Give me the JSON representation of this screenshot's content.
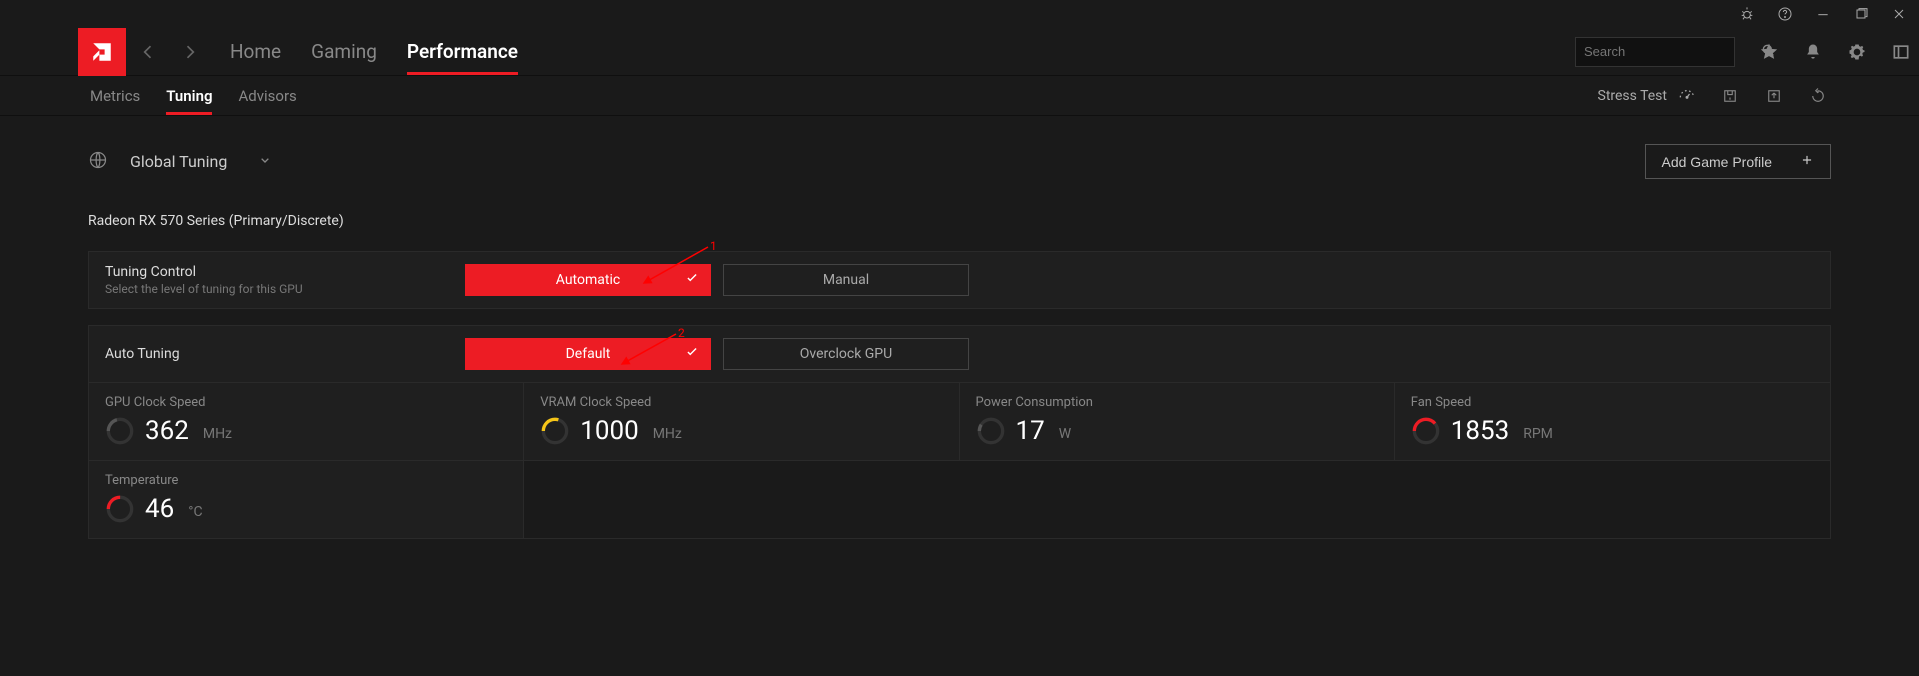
{
  "titlebar": {
    "icons": [
      "bug",
      "help",
      "minimize",
      "maximize",
      "close"
    ]
  },
  "nav": {
    "tabs": [
      "Home",
      "Gaming",
      "Performance"
    ],
    "active": "Performance"
  },
  "search": {
    "placeholder": "Search"
  },
  "subnav": {
    "tabs": [
      "Metrics",
      "Tuning",
      "Advisors"
    ],
    "active": "Tuning",
    "stress_test": "Stress Test"
  },
  "global": {
    "label": "Global Tuning",
    "add_profile": "Add Game Profile"
  },
  "gpu": {
    "name": "Radeon RX 570 Series (Primary/Discrete)"
  },
  "tuning_control": {
    "title": "Tuning Control",
    "subtitle": "Select the level of tuning for this GPU",
    "automatic": "Automatic",
    "manual": "Manual"
  },
  "auto_tuning": {
    "title": "Auto Tuning",
    "default": "Default",
    "overclock": "Overclock GPU"
  },
  "metrics": {
    "gpu_clock": {
      "label": "GPU Clock Speed",
      "value": "362",
      "unit": "MHz",
      "color": "#555"
    },
    "vram_clock": {
      "label": "VRAM Clock Speed",
      "value": "1000",
      "unit": "MHz",
      "color": "#f5c518"
    },
    "power": {
      "label": "Power Consumption",
      "value": "17",
      "unit": "W",
      "color": "#555"
    },
    "fan": {
      "label": "Fan Speed",
      "value": "1853",
      "unit": "RPM",
      "color": "#ed1c24"
    },
    "temp": {
      "label": "Temperature",
      "value": "46",
      "unit": "°C",
      "color": "#ed1c24"
    }
  },
  "annotations": {
    "one": "1",
    "two": "2"
  }
}
